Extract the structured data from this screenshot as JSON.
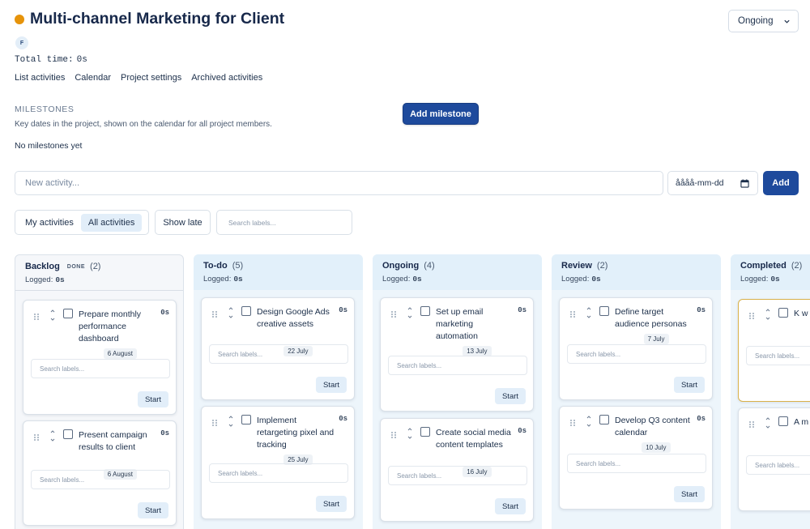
{
  "header": {
    "title": "Multi-channel Marketing for Client",
    "status_value": "Ongoing",
    "status_color": "#e6930a",
    "avatar_initial": "F",
    "total_time_label": "Total time:",
    "total_time_value": "0s"
  },
  "nav": {
    "items": [
      "List activities",
      "Calendar",
      "Project settings",
      "Archived activities"
    ]
  },
  "milestones": {
    "heading": "MILESTONES",
    "description": "Key dates in the project, shown on the calendar for all project members.",
    "empty_text": "No milestones yet",
    "add_button": "Add milestone"
  },
  "new_activity": {
    "placeholder": "New activity...",
    "date_value": "åååå-mm-dd",
    "add_button": "Add"
  },
  "filters": {
    "my_activities": "My activities",
    "all_activities": "All activities",
    "show_late": "Show late",
    "search_placeholder": "Search labels..."
  },
  "board": {
    "logged_label": "Logged:",
    "search_placeholder": "Search labels...",
    "start_label": "Start",
    "columns": [
      {
        "name": "Backlog",
        "badge": "DONE",
        "count": "(2)",
        "logged": "0s",
        "cards": [
          {
            "title": "Prepare monthly performance dashboard",
            "time": "0s",
            "date": "6 August"
          },
          {
            "title": "Present campaign results to client",
            "time": "0s",
            "date": "6 August"
          }
        ]
      },
      {
        "name": "To-do",
        "badge": "",
        "count": "(5)",
        "logged": "0s",
        "cards": [
          {
            "title": "Design Google Ads creative assets",
            "time": "0s",
            "date": "22 July"
          },
          {
            "title": "Implement retargeting pixel and tracking",
            "time": "0s",
            "date": "25 July"
          }
        ]
      },
      {
        "name": "Ongoing",
        "badge": "",
        "count": "(4)",
        "logged": "0s",
        "cards": [
          {
            "title": "Set up email marketing automation",
            "time": "0s",
            "date": "13 July"
          },
          {
            "title": "Create social media content templates",
            "time": "0s",
            "date": "16 July"
          }
        ]
      },
      {
        "name": "Review",
        "badge": "",
        "count": "(2)",
        "logged": "0s",
        "cards": [
          {
            "title": "Define target audience personas",
            "time": "0s",
            "date": "7 July"
          },
          {
            "title": "Develop Q3 content calendar",
            "time": "0s",
            "date": "10 July"
          }
        ]
      },
      {
        "name": "Completed",
        "badge": "",
        "count": "(2)",
        "logged": "0s",
        "cards": [
          {
            "title": "K w",
            "time": "",
            "date": ""
          },
          {
            "title": "A m",
            "time": "",
            "date": ""
          }
        ]
      }
    ]
  }
}
